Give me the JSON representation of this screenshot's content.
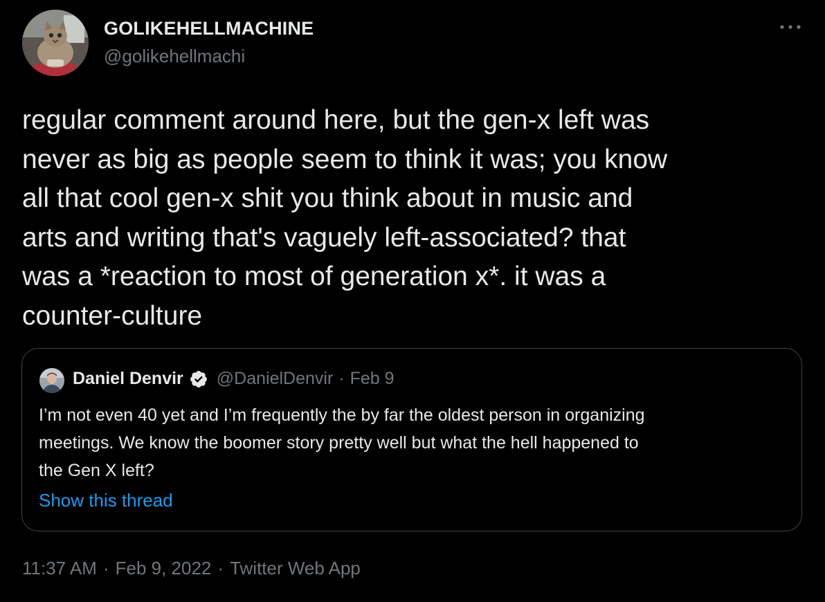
{
  "tweet": {
    "author": {
      "display_name": "GOLIKEHELLMACHINE",
      "handle": "@golikehellmachi",
      "avatar_icon": "cat-avatar"
    },
    "more_icon": "ellipsis-icon",
    "text": "regular comment around here, but the gen-x left was\nnever as big as people seem to think it was; you know\nall that cool gen-x shit you think about in music and\narts and writing that's vaguely left-associated? that\nwas a *reaction to most of generation x*. it was a\ncounter-culture",
    "time": "11:37 AM",
    "date": "Feb 9, 2022",
    "source": "Twitter Web App",
    "separator": "·"
  },
  "quote": {
    "display_name": "Daniel Denvir",
    "verified_icon": "verified-badge-icon",
    "handle": "@DanielDenvir",
    "separator": "·",
    "date": "Feb 9",
    "text": "I’m not even 40 yet and I’m frequently the by far the oldest person in organizing\nmeetings. We know the boomer story pretty well but what the hell happened to\nthe Gen X left?",
    "show_thread_label": "Show this thread"
  },
  "colors": {
    "background": "#000000",
    "primary_text": "#e7e9ea",
    "secondary_text": "#71767b",
    "link": "#1d9bf0",
    "border": "#3e4144"
  }
}
